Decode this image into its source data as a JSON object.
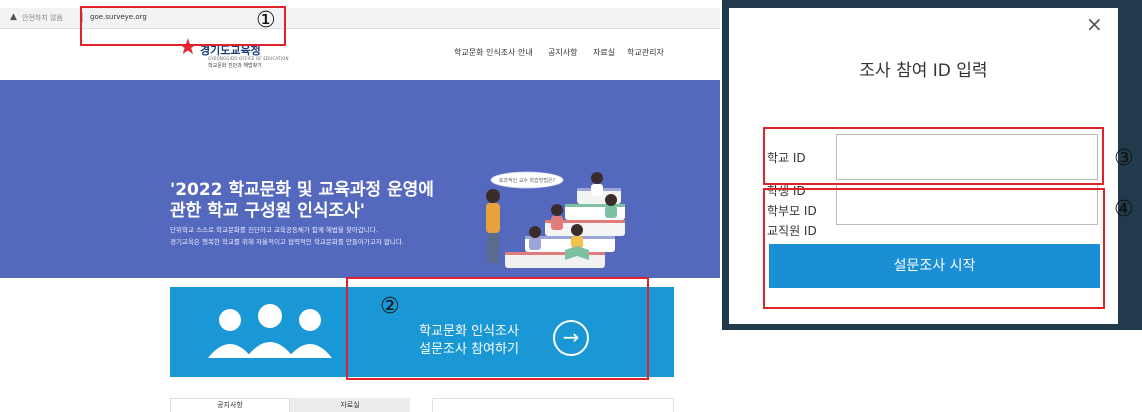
{
  "browser": {
    "warning_icon": "warning-triangle-icon",
    "warning_text": "안전하지 않음",
    "url": "goe.surveye.org"
  },
  "site": {
    "logo_text": "경기도교육청",
    "logo_sub_en": "GYEONGGIDO OFFICE OF EDUCATION",
    "logo_sub_kr": "학교문화 진단과 해법찾기",
    "nav": [
      "학교문화 인식조사 안내",
      "공지사항",
      "자료실",
      "학교관리자"
    ]
  },
  "hero": {
    "title_line1": "'2022 학교문화 및 교육과정 운영에",
    "title_line2": "관한 학교 구성원 인식조사'",
    "desc_line1": "단위학교 스스로 학교문화를 진단하고 교육공동체가 함께 해법을 찾아갑니다.",
    "desc_line2": "경기교육은 행복한 학교를 위해 자율적이고 협력적인 학교문화를 만들어가고자 합니다.",
    "speech_bubble": "효과적인 교수 학습방법은?"
  },
  "banner": {
    "line1": "학교문화 인식조사",
    "line2": "설문조사 참여하기",
    "arrow_icon": "arrow-right-circle-icon",
    "people_icon": "people-group-icon"
  },
  "tabs": {
    "notice": "공지사항",
    "data": "자료실"
  },
  "modal": {
    "close_symbol": "×",
    "title": "조사 참여 ID 입력",
    "school_label": "학교 ID",
    "role_labels": [
      "학생 ID",
      "학부모 ID",
      "교직원 ID"
    ],
    "start_button": "설문조사 시작"
  },
  "markers": {
    "m1": "①",
    "m2": "②",
    "m3": "③",
    "m4": "④"
  },
  "colors": {
    "hero_bg": "#5468be",
    "banner_bg": "#1a97d5",
    "button_bg": "#1a8fd5",
    "highlight_red": "#e0232a",
    "backdrop": "#213a4c"
  }
}
